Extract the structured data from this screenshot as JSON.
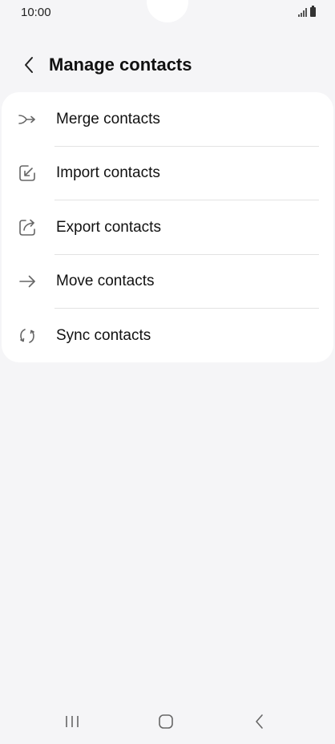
{
  "status_bar": {
    "time": "10:00",
    "icons": [
      "signal-icon",
      "battery-icon"
    ]
  },
  "header": {
    "title": "Manage contacts",
    "back_icon": "chevron-left-icon"
  },
  "menu": {
    "items": [
      {
        "label": "Merge contacts",
        "icon": "merge-icon"
      },
      {
        "label": "Import contacts",
        "icon": "import-icon"
      },
      {
        "label": "Export contacts",
        "icon": "export-icon"
      },
      {
        "label": "Move contacts",
        "icon": "arrow-right-icon"
      },
      {
        "label": "Sync contacts",
        "icon": "sync-icon"
      }
    ]
  },
  "nav_bar": {
    "buttons": [
      "recent-apps-icon",
      "home-icon",
      "back-icon"
    ]
  },
  "colors": {
    "background": "#f5f5f7",
    "card": "#ffffff",
    "text": "#111111",
    "icon": "#666666",
    "divider": "#e3e3e3"
  }
}
